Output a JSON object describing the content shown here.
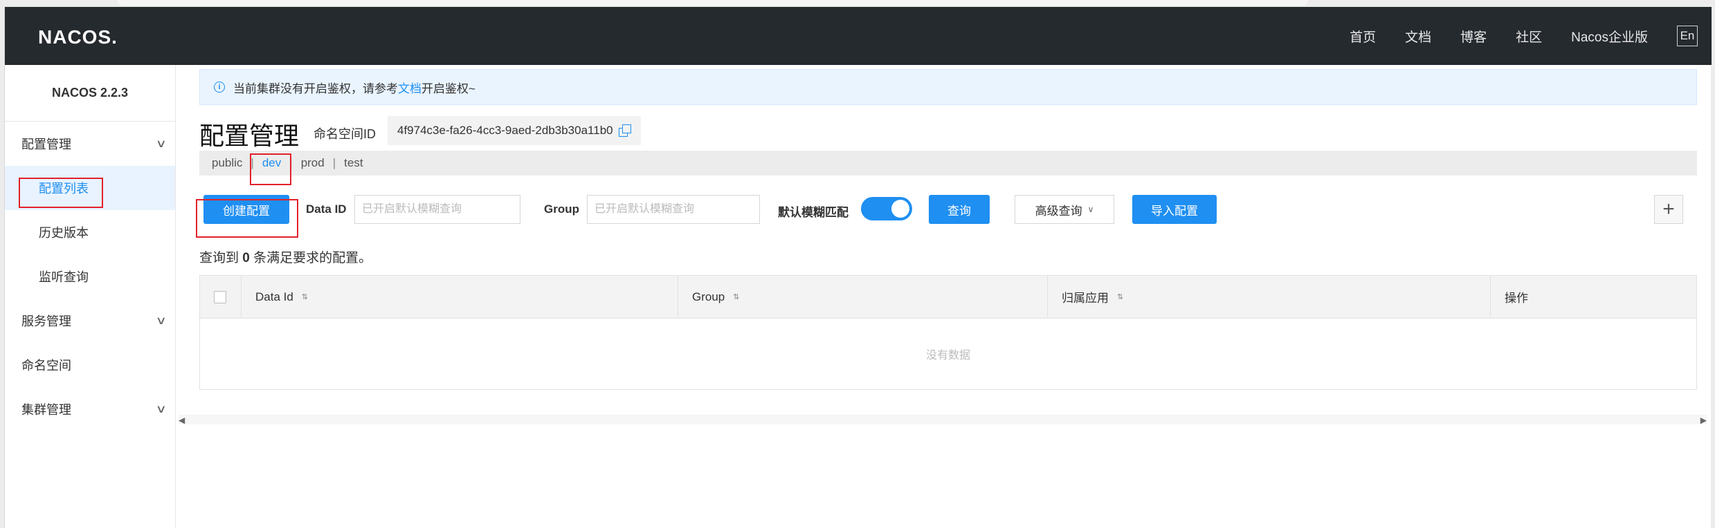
{
  "header": {
    "logo": "NACOS.",
    "nav": [
      "首页",
      "文档",
      "博客",
      "社区",
      "Nacos企业版"
    ],
    "lang": "En"
  },
  "sidebar": {
    "version": "NACOS 2.2.3",
    "groups": [
      {
        "label": "配置管理",
        "expanded": true,
        "items": [
          {
            "label": "配置列表",
            "active": true
          },
          {
            "label": "历史版本"
          },
          {
            "label": "监听查询"
          }
        ]
      },
      {
        "label": "服务管理",
        "expanded": false
      },
      {
        "label": "命名空间"
      },
      {
        "label": "集群管理",
        "expanded": false
      }
    ]
  },
  "notice": {
    "prefix": "当前集群没有开启鉴权，请参考",
    "link": "文档",
    "suffix": "开启鉴权~"
  },
  "page": {
    "title": "配置管理",
    "namespace_label": "命名空间ID",
    "namespace_id": "4f974c3e-fa26-4cc3-9aed-2db3b30a11b0"
  },
  "namespaces": [
    "public",
    "dev",
    "prod",
    "test"
  ],
  "active_namespace": "dev",
  "toolbar": {
    "create_label": "创建配置",
    "dataid_label": "Data ID",
    "dataid_placeholder": "已开启默认模糊查询",
    "group_label": "Group",
    "group_placeholder": "已开启默认模糊查询",
    "fuzzy_label": "默认模糊匹配",
    "fuzzy_on": true,
    "query_label": "查询",
    "advanced_label": "高级查询",
    "import_label": "导入配置",
    "plus": "+"
  },
  "result": {
    "prefix": "查询到",
    "count": "0",
    "suffix": "条满足要求的配置。"
  },
  "table": {
    "columns": [
      "Data Id",
      "Group",
      "归属应用",
      "操作"
    ],
    "empty_text": "没有数据"
  },
  "colors": {
    "header_bg": "#252a2f",
    "accent": "#1f8ff2",
    "highlight": "#e3212b"
  }
}
